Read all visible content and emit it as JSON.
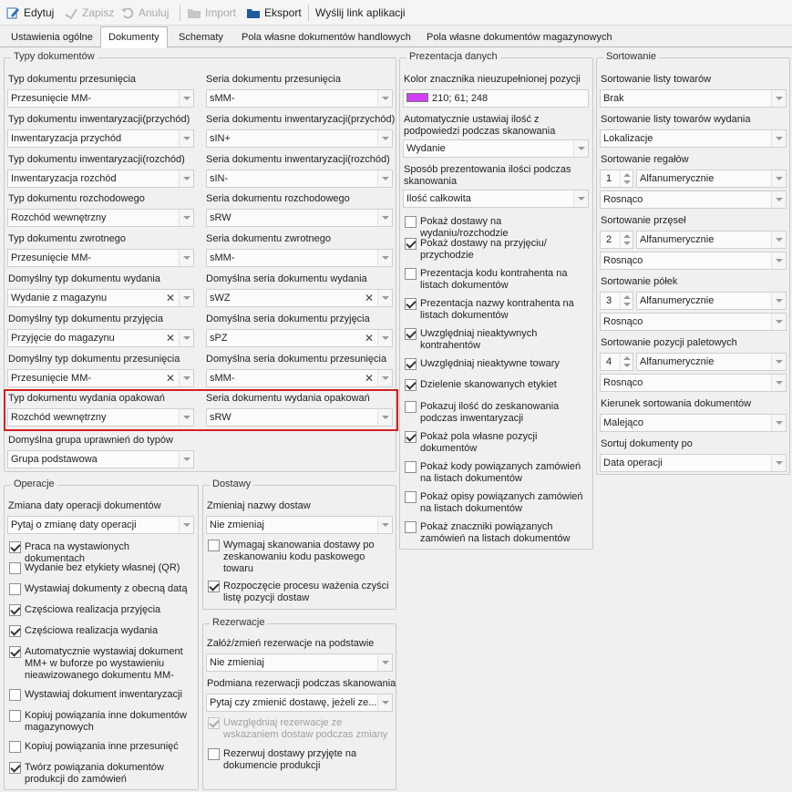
{
  "toolbar": {
    "edit": "Edytuj",
    "save": "Zapisz",
    "cancel": "Anuluj",
    "import": "Import",
    "export": "Eksport",
    "send_link": "Wyślij link aplikacji"
  },
  "tabs": [
    "Ustawienia ogólne",
    "Dokumenty",
    "Schematy",
    "Pola własne dokumentów handlowych",
    "Pola własne dokumentów magazynowych"
  ],
  "types": {
    "title": "Typy dokumentów",
    "rows": [
      {
        "l1": "Typ dokumentu przesunięcia",
        "v1": "Przesunięcie MM-",
        "l2": "Seria dokumentu przesunięcia",
        "v2": "sMM-"
      },
      {
        "l1": "Typ dokumentu inwentaryzacji(przychód)",
        "v1": "Inwentaryzacja przychód",
        "l2": "Seria dokumentu inwentaryzacji(przychód)",
        "v2": "sIN+"
      },
      {
        "l1": "Typ dokumentu inwentaryzacji(rozchód)",
        "v1": "Inwentaryzacja rozchód",
        "l2": "Seria dokumentu inwentaryzacji(rozchód)",
        "v2": "sIN-"
      },
      {
        "l1": "Typ dokumentu rozchodowego",
        "v1": "Rozchód wewnętrzny",
        "l2": "Seria dokumentu rozchodowego",
        "v2": "sRW"
      },
      {
        "l1": "Typ dokumentu zwrotnego",
        "v1": "Przesunięcie MM-",
        "l2": "Seria dokumentu zwrotnego",
        "v2": "sMM-"
      },
      {
        "l1": "Domyślny typ dokumentu wydania",
        "v1": "Wydanie z magazynu",
        "l2": "Domyślna seria dokumentu wydania",
        "v2": "sWZ"
      },
      {
        "l1": "Domyślny typ dokumentu przyjęcia",
        "v1": "Przyjęcie do magazynu",
        "l2": "Domyślna seria dokumentu przyjęcia",
        "v2": "sPZ"
      },
      {
        "l1": "Domyślny typ dokumentu przesunięcia",
        "v1": "Przesunięcie MM-",
        "l2": "Domyślna seria dokumentu przesunięcia",
        "v2": "sMM-"
      },
      {
        "l1": "Typ dokumentu wydania opakowań",
        "v1": "Rozchód wewnętrzny",
        "l2": "Seria dokumentu wydania opakowań",
        "v2": "sRW"
      }
    ],
    "group_perm_label": "Domyślna grupa uprawnień do typów",
    "group_perm_value": "Grupa podstawowa"
  },
  "operations": {
    "title": "Operacje",
    "date_label": "Zmiana daty operacji dokumentów",
    "date_value": "Pytaj o zmianę daty operacji",
    "checks": [
      {
        "t": "Praca na wystawionych dokumentach",
        "on": true
      },
      {
        "t": "Wydanie bez etykiety własnej (QR)",
        "on": false
      },
      {
        "t": "Wystawiaj dokumenty z obecną datą",
        "on": false
      },
      {
        "t": "Częściowa realizacja przyjęcia",
        "on": true
      },
      {
        "t": "Częściowa realizacja wydania",
        "on": true
      },
      {
        "t": "Automatycznie wystawiaj dokument MM+ w buforze po wystawieniu nieawizowanego dokumentu MM-",
        "on": true
      },
      {
        "t": "Wystawiaj dokument inwentaryzacji",
        "on": false
      },
      {
        "t": "Kopiuj powiązania inne dokumentów magazynowych",
        "on": false
      },
      {
        "t": "Kopiuj powiązania inne przesunięć",
        "on": false
      },
      {
        "t": "Twórz powiązania dokumentów produkcji do zamówień",
        "on": true
      }
    ]
  },
  "deliveries": {
    "title": "Dostawy",
    "name_label": "Zmieniaj nazwy dostaw",
    "name_value": "Nie zmieniaj",
    "checks": [
      {
        "t": "Wymagaj skanowania dostawy po zeskanowaniu kodu paskowego towaru",
        "on": false
      },
      {
        "t": "Rozpoczęcie procesu ważenia czyści listę pozycji dostaw",
        "on": true
      }
    ]
  },
  "reservations": {
    "title": "Rezerwacje",
    "create_label": "Załóż/zmień rezerwacje na podstawie",
    "create_value": "Nie zmieniaj",
    "swap_label": "Podmiana rezerwacji podczas skanowania",
    "swap_value": "Pytaj czy zmienić dostawę, jeżeli ze...",
    "checks": [
      {
        "t": "Uwzględniaj rezerwacje ze wskazaniem dostaw podczas zmiany",
        "on": true,
        "disabled": true
      },
      {
        "t": "Rezerwuj dostawy przyjęte na dokumencie produkcji",
        "on": false
      }
    ]
  },
  "presentation": {
    "title": "Prezentacja danych",
    "color_label": "Kolor znacznika nieuzupełnionej pozycji",
    "color_value": "210; 61; 248",
    "color_hex": "#d23df8",
    "auto_qty_label": "Automatycznie ustawiaj ilość z podpowiedzi podczas skanowania",
    "auto_qty_value": "Wydanie",
    "qty_mode_label": "Sposób prezentowania ilości podczas skanowania",
    "qty_mode_value": "Ilość całkowita",
    "checks": [
      {
        "t": "Pokaż dostawy na wydaniu/rozchodzie",
        "on": false
      },
      {
        "t": "Pokaż dostawy na przyjęciu/ przychodzie",
        "on": true
      },
      {
        "t": "Prezentacja kodu kontrahenta na listach dokumentów",
        "on": false
      },
      {
        "t": "Prezentacja nazwy kontrahenta na listach dokumentów",
        "on": true
      },
      {
        "t": "Uwzględniaj nieaktywnych kontrahentów",
        "on": true
      },
      {
        "t": "Uwzględniaj nieaktywne towary",
        "on": true
      },
      {
        "t": "Dzielenie skanowanych etykiet",
        "on": true
      },
      {
        "t": "Pokazuj ilość do zeskanowania podczas inwentaryzacji",
        "on": false
      },
      {
        "t": "Pokaż pola własne pozycji dokumentów",
        "on": true
      },
      {
        "t": "Pokaż kody powiązanych zamówień na listach dokumentów",
        "on": false
      },
      {
        "t": "Pokaż opisy powiązanych zamówień na listach dokumentów",
        "on": false
      },
      {
        "t": "Pokaż znaczniki powiązanych zamówień na listach dokumentów",
        "on": false
      }
    ]
  },
  "sorting": {
    "title": "Sortowanie",
    "items_label": "Sortowanie listy towarów",
    "items_value": "Brak",
    "issue_label": "Sortowanie listy towarów wydania",
    "issue_value": "Lokalizacje",
    "shelves_label": "Sortowanie regałów",
    "bays_label": "Sortowanie przęseł",
    "levels_label": "Sortowanie półek",
    "pallets_label": "Sortowanie pozycji paletowych",
    "shelves": {
      "num": "1",
      "mode": "Alfanumerycznie",
      "dir": "Rosnąco"
    },
    "bays": {
      "num": "2",
      "mode": "Alfanumerycznie",
      "dir": "Rosnąco"
    },
    "levels": {
      "num": "3",
      "mode": "Alfanumerycznie",
      "dir": "Rosnąco"
    },
    "pallets": {
      "num": "4",
      "mode": "Alfanumerycznie",
      "dir": "Rosnąco"
    },
    "docdir_label": "Kierunek sortowania dokumentów",
    "docdir_value": "Malejąco",
    "docsort_label": "Sortuj dokumenty po",
    "docsort_value": "Data operacji"
  }
}
